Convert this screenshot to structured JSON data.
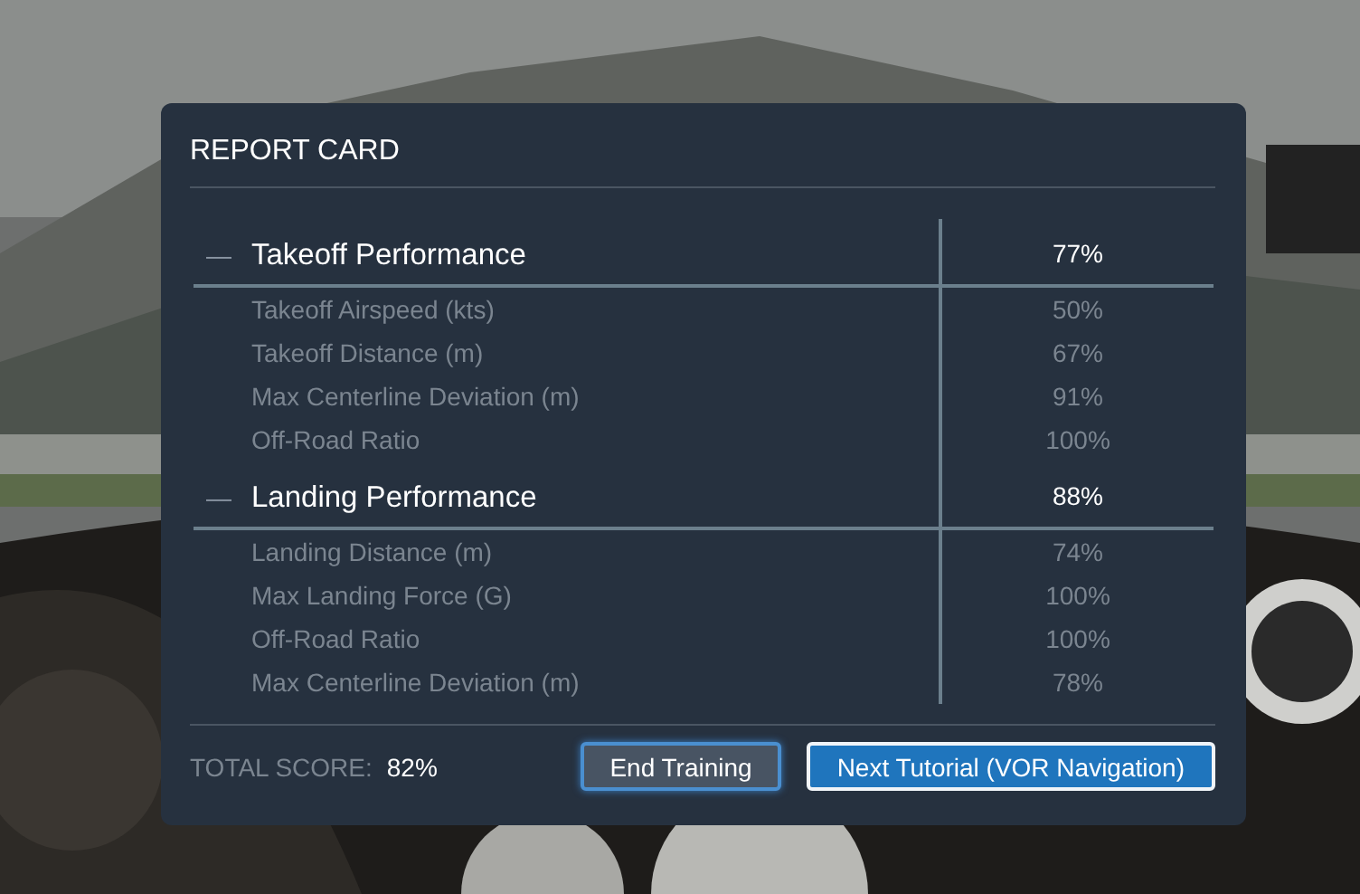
{
  "dialog": {
    "title": "REPORT CARD",
    "sections": [
      {
        "toggle": "—",
        "expanded": true,
        "name": "Takeoff Performance",
        "score": "77%",
        "items": [
          {
            "name": "Takeoff Airspeed (kts)",
            "score": "50%"
          },
          {
            "name": "Takeoff Distance (m)",
            "score": "67%"
          },
          {
            "name": "Max Centerline Deviation (m)",
            "score": "91%"
          },
          {
            "name": "Off-Road Ratio",
            "score": "100%"
          }
        ]
      },
      {
        "toggle": "—",
        "expanded": true,
        "name": "Landing Performance",
        "score": "88%",
        "items": [
          {
            "name": "Landing Distance (m)",
            "score": "74%"
          },
          {
            "name": "Max Landing Force (G)",
            "score": "100%"
          },
          {
            "name": "Off-Road Ratio",
            "score": "100%"
          },
          {
            "name": "Max Centerline Deviation (m)",
            "score": "78%"
          }
        ]
      }
    ],
    "total_label": "TOTAL SCORE:",
    "total_value": "82%",
    "buttons": [
      {
        "label": "End Training",
        "kind": "secondary"
      },
      {
        "label": "Next Tutorial (VOR Navigation)",
        "kind": "primary"
      }
    ]
  }
}
